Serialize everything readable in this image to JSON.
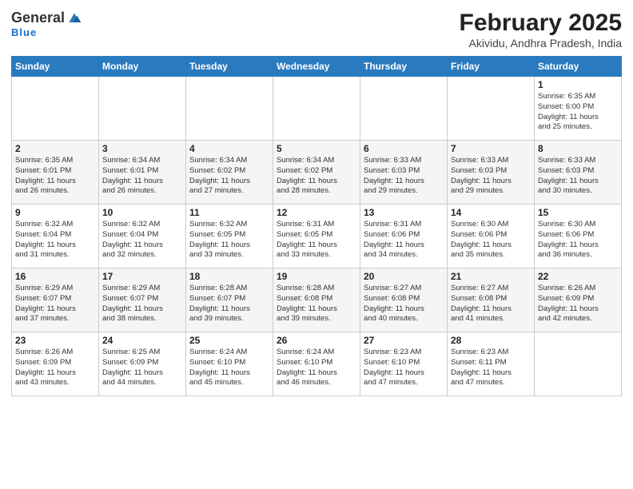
{
  "logo": {
    "general": "General",
    "blue": "Blue",
    "subtitle": "Blue"
  },
  "title": "February 2025",
  "location": "Akividu, Andhra Pradesh, India",
  "days_of_week": [
    "Sunday",
    "Monday",
    "Tuesday",
    "Wednesday",
    "Thursday",
    "Friday",
    "Saturday"
  ],
  "weeks": [
    [
      {
        "day": "",
        "info": ""
      },
      {
        "day": "",
        "info": ""
      },
      {
        "day": "",
        "info": ""
      },
      {
        "day": "",
        "info": ""
      },
      {
        "day": "",
        "info": ""
      },
      {
        "day": "",
        "info": ""
      },
      {
        "day": "1",
        "info": "Sunrise: 6:35 AM\nSunset: 6:00 PM\nDaylight: 11 hours\nand 25 minutes."
      }
    ],
    [
      {
        "day": "2",
        "info": "Sunrise: 6:35 AM\nSunset: 6:01 PM\nDaylight: 11 hours\nand 26 minutes."
      },
      {
        "day": "3",
        "info": "Sunrise: 6:34 AM\nSunset: 6:01 PM\nDaylight: 11 hours\nand 26 minutes."
      },
      {
        "day": "4",
        "info": "Sunrise: 6:34 AM\nSunset: 6:02 PM\nDaylight: 11 hours\nand 27 minutes."
      },
      {
        "day": "5",
        "info": "Sunrise: 6:34 AM\nSunset: 6:02 PM\nDaylight: 11 hours\nand 28 minutes."
      },
      {
        "day": "6",
        "info": "Sunrise: 6:33 AM\nSunset: 6:03 PM\nDaylight: 11 hours\nand 29 minutes."
      },
      {
        "day": "7",
        "info": "Sunrise: 6:33 AM\nSunset: 6:03 PM\nDaylight: 11 hours\nand 29 minutes."
      },
      {
        "day": "8",
        "info": "Sunrise: 6:33 AM\nSunset: 6:03 PM\nDaylight: 11 hours\nand 30 minutes."
      }
    ],
    [
      {
        "day": "9",
        "info": "Sunrise: 6:32 AM\nSunset: 6:04 PM\nDaylight: 11 hours\nand 31 minutes."
      },
      {
        "day": "10",
        "info": "Sunrise: 6:32 AM\nSunset: 6:04 PM\nDaylight: 11 hours\nand 32 minutes."
      },
      {
        "day": "11",
        "info": "Sunrise: 6:32 AM\nSunset: 6:05 PM\nDaylight: 11 hours\nand 33 minutes."
      },
      {
        "day": "12",
        "info": "Sunrise: 6:31 AM\nSunset: 6:05 PM\nDaylight: 11 hours\nand 33 minutes."
      },
      {
        "day": "13",
        "info": "Sunrise: 6:31 AM\nSunset: 6:06 PM\nDaylight: 11 hours\nand 34 minutes."
      },
      {
        "day": "14",
        "info": "Sunrise: 6:30 AM\nSunset: 6:06 PM\nDaylight: 11 hours\nand 35 minutes."
      },
      {
        "day": "15",
        "info": "Sunrise: 6:30 AM\nSunset: 6:06 PM\nDaylight: 11 hours\nand 36 minutes."
      }
    ],
    [
      {
        "day": "16",
        "info": "Sunrise: 6:29 AM\nSunset: 6:07 PM\nDaylight: 11 hours\nand 37 minutes."
      },
      {
        "day": "17",
        "info": "Sunrise: 6:29 AM\nSunset: 6:07 PM\nDaylight: 11 hours\nand 38 minutes."
      },
      {
        "day": "18",
        "info": "Sunrise: 6:28 AM\nSunset: 6:07 PM\nDaylight: 11 hours\nand 39 minutes."
      },
      {
        "day": "19",
        "info": "Sunrise: 6:28 AM\nSunset: 6:08 PM\nDaylight: 11 hours\nand 39 minutes."
      },
      {
        "day": "20",
        "info": "Sunrise: 6:27 AM\nSunset: 6:08 PM\nDaylight: 11 hours\nand 40 minutes."
      },
      {
        "day": "21",
        "info": "Sunrise: 6:27 AM\nSunset: 6:08 PM\nDaylight: 11 hours\nand 41 minutes."
      },
      {
        "day": "22",
        "info": "Sunrise: 6:26 AM\nSunset: 6:09 PM\nDaylight: 11 hours\nand 42 minutes."
      }
    ],
    [
      {
        "day": "23",
        "info": "Sunrise: 6:26 AM\nSunset: 6:09 PM\nDaylight: 11 hours\nand 43 minutes."
      },
      {
        "day": "24",
        "info": "Sunrise: 6:25 AM\nSunset: 6:09 PM\nDaylight: 11 hours\nand 44 minutes."
      },
      {
        "day": "25",
        "info": "Sunrise: 6:24 AM\nSunset: 6:10 PM\nDaylight: 11 hours\nand 45 minutes."
      },
      {
        "day": "26",
        "info": "Sunrise: 6:24 AM\nSunset: 6:10 PM\nDaylight: 11 hours\nand 46 minutes."
      },
      {
        "day": "27",
        "info": "Sunrise: 6:23 AM\nSunset: 6:10 PM\nDaylight: 11 hours\nand 47 minutes."
      },
      {
        "day": "28",
        "info": "Sunrise: 6:23 AM\nSunset: 6:11 PM\nDaylight: 11 hours\nand 47 minutes."
      },
      {
        "day": "",
        "info": ""
      }
    ]
  ]
}
